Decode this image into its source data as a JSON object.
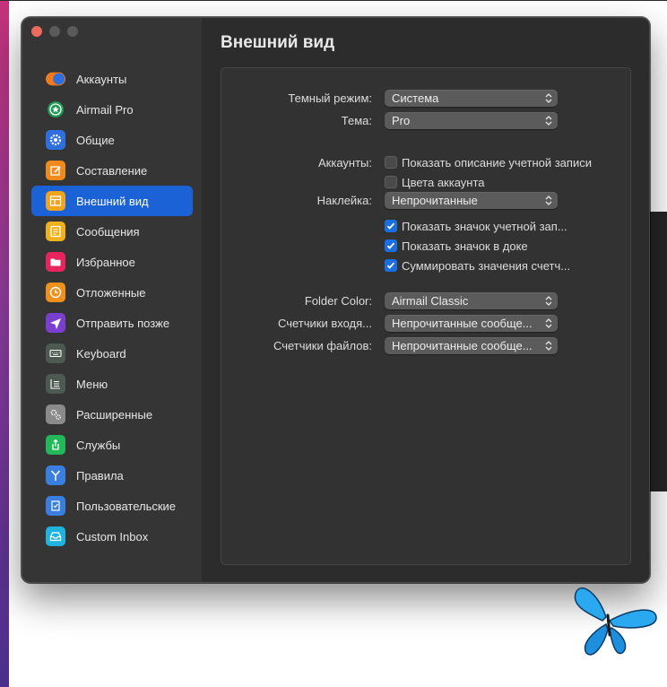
{
  "window": {
    "title": "Внешний вид"
  },
  "sidebar": {
    "items": [
      {
        "label": "Аккаунты",
        "icon": "accounts-icon",
        "active": false
      },
      {
        "label": "Airmail Pro",
        "icon": "airmail-pro-star-icon",
        "active": false
      },
      {
        "label": "Общие",
        "icon": "gear-icon",
        "active": false
      },
      {
        "label": "Составление",
        "icon": "compose-icon",
        "active": false
      },
      {
        "label": "Внешний вид",
        "icon": "appearance-icon",
        "active": true
      },
      {
        "label": "Сообщения",
        "icon": "messages-icon",
        "active": false
      },
      {
        "label": "Избранное",
        "icon": "folder-icon",
        "active": false
      },
      {
        "label": "Отложенные",
        "icon": "clock-icon",
        "active": false
      },
      {
        "label": "Отправить позже",
        "icon": "send-later-icon",
        "active": false
      },
      {
        "label": "Keyboard",
        "icon": "keyboard-icon",
        "active": false
      },
      {
        "label": "Меню",
        "icon": "menu-icon",
        "active": false
      },
      {
        "label": "Расширенные",
        "icon": "advanced-gears-icon",
        "active": false
      },
      {
        "label": "Службы",
        "icon": "share-icon",
        "active": false
      },
      {
        "label": "Правила",
        "icon": "rules-icon",
        "active": false
      },
      {
        "label": "Пользовательские",
        "icon": "custom-icon",
        "active": false
      },
      {
        "label": "Custom Inbox",
        "icon": "inbox-icon",
        "active": false
      }
    ]
  },
  "settings": {
    "dark_mode": {
      "label": "Темный режим:",
      "value": "Система"
    },
    "theme": {
      "label": "Тема:",
      "value": "Pro"
    },
    "accounts": {
      "label": "Аккаунты:",
      "show_description": {
        "label": "Показать описание учетной записи",
        "checked": false
      },
      "account_colors": {
        "label": "Цвета аккаунта",
        "checked": false
      }
    },
    "badge": {
      "label": "Наклейка:",
      "value": "Непрочитанные",
      "show_account_icon": {
        "label": "Показать значок учетной зап...",
        "checked": true
      },
      "show_dock_icon": {
        "label": "Показать значок в доке",
        "checked": true
      },
      "sum_counters": {
        "label": "Суммировать значения счетч...",
        "checked": true
      }
    },
    "folder_color": {
      "label": "Folder Color:",
      "value": "Airmail Classic"
    },
    "inbox_counters": {
      "label": "Счетчики входя...",
      "value": "Непрочитанные сообще..."
    },
    "file_counters": {
      "label": "Счетчики файлов:",
      "value": "Непрочитанные сообще..."
    }
  },
  "colors": {
    "accent": "#1a62d5",
    "window_bg": "#2c2c2c",
    "sidebar_bg": "#353535"
  }
}
